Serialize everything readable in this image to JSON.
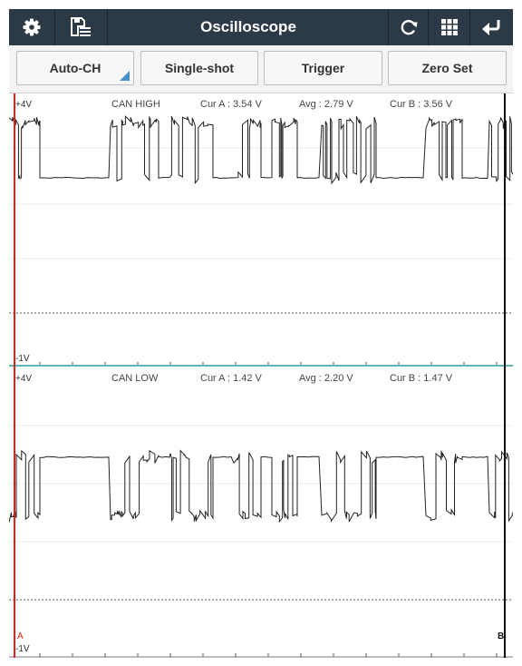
{
  "app": {
    "title": "Oscilloscope"
  },
  "toolbar": {
    "left_icons": [
      "gear-icon",
      "save-list-icon"
    ],
    "right_icons": [
      "refresh-icon",
      "grid-icon",
      "back-icon"
    ]
  },
  "buttons": [
    {
      "name": "auto-ch-button",
      "label": "Auto-CH",
      "has_dropdown": true
    },
    {
      "name": "single-shot-button",
      "label": "Single-shot"
    },
    {
      "name": "trigger-button",
      "label": "Trigger"
    },
    {
      "name": "zero-set-button",
      "label": "Zero Set"
    }
  ],
  "colors": {
    "toolbar_bg": "#2c3a47",
    "cursor_a": "#e02020",
    "cursor_b": "#111111",
    "channel_divider": "#5fb4b4",
    "dropdown_marker": "#4a90c8"
  },
  "cursors": {
    "a_label": "A",
    "b_label": "B"
  },
  "channels": [
    {
      "name": "CAN HIGH",
      "max_label": "+4V",
      "min_label": "-1V",
      "cur_a": "Cur A : 3.54 V",
      "avg": "Avg : 2.79 V",
      "cur_b": "Cur B : 3.56 V",
      "high_level_v": 3.55,
      "low_level_v": 2.5,
      "idle_state": "low"
    },
    {
      "name": "CAN LOW",
      "max_label": "+4V",
      "min_label": "-1V",
      "cur_a": "Cur A : 1.42 V",
      "avg": "Avg : 2.20 V",
      "cur_b": "Cur B : 1.47 V",
      "high_level_v": 2.5,
      "low_level_v": 1.45,
      "idle_state": "high"
    }
  ]
}
